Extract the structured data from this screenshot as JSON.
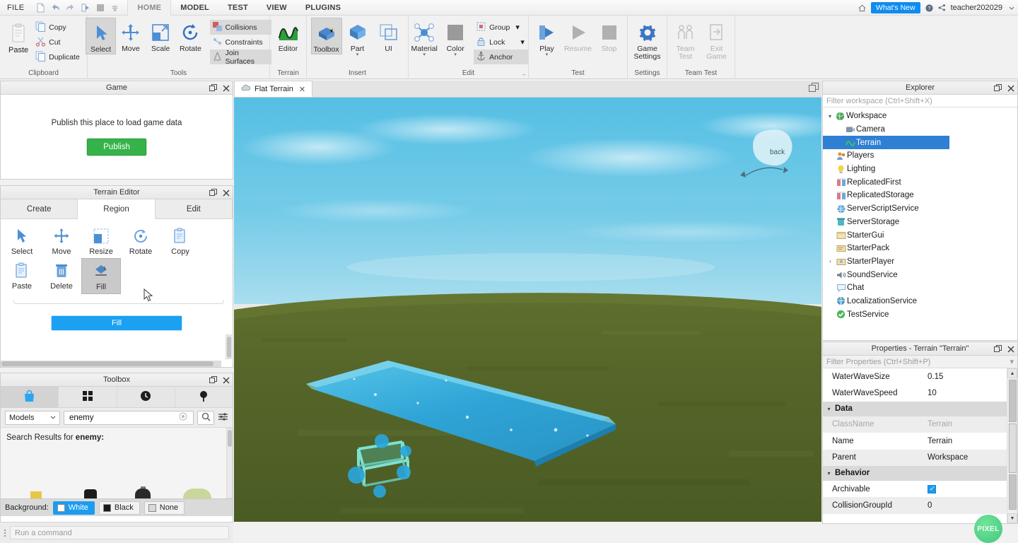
{
  "menubar": {
    "file_label": "FILE",
    "quick_access": [
      "new-file-icon",
      "undo-icon",
      "redo-icon",
      "play-forward-icon",
      "stop-square-icon",
      "qat-dropdown-icon"
    ],
    "tabs": [
      {
        "label": "HOME",
        "active": true
      },
      {
        "label": "MODEL",
        "active": false
      },
      {
        "label": "TEST",
        "active": false
      },
      {
        "label": "VIEW",
        "active": false
      },
      {
        "label": "PLUGINS",
        "active": false
      }
    ],
    "right": {
      "home_icon": "home-icon",
      "whats_new": "What's New",
      "help_icon": "help-icon",
      "share_icon": "share-icon",
      "user": "teacher202029",
      "user_caret": "chevron-down-icon"
    }
  },
  "ribbon": {
    "groups": [
      {
        "title": "Clipboard",
        "paste": {
          "label": "Paste",
          "disabled": true
        },
        "items": [
          {
            "label": "Copy",
            "icon": "copy-icon"
          },
          {
            "label": "Cut",
            "icon": "cut-icon"
          },
          {
            "label": "Duplicate",
            "icon": "duplicate-icon"
          }
        ]
      },
      {
        "title": "Tools",
        "big": [
          {
            "label": "Select",
            "icon": "cursor-arrow-icon",
            "selected": true
          },
          {
            "label": "Move",
            "icon": "move-arrows-icon",
            "selected": false
          },
          {
            "label": "Scale",
            "icon": "scale-icon",
            "selected": false
          },
          {
            "label": "Rotate",
            "icon": "rotate-icon",
            "selected": false
          }
        ],
        "small": [
          {
            "label": "Collisions",
            "icon": "collisions-icon",
            "selected": true
          },
          {
            "label": "Constraints",
            "icon": "constraints-icon",
            "selected": false
          },
          {
            "label": "Join Surfaces",
            "icon": "join-surfaces-icon",
            "selected": true
          }
        ]
      },
      {
        "title": "Terrain",
        "big": [
          {
            "label": "Editor",
            "icon": "terrain-editor-icon",
            "selected": false
          }
        ]
      },
      {
        "title": "Insert",
        "big": [
          {
            "label": "Toolbox",
            "icon": "toolbox-icon",
            "selected": true
          },
          {
            "label": "Part",
            "icon": "part-cube-icon",
            "caret": true
          },
          {
            "label": "UI",
            "icon": "ui-frame-icon"
          }
        ]
      },
      {
        "title": "Edit",
        "big": [
          {
            "label": "Material",
            "icon": "material-icon",
            "caret": true
          },
          {
            "label": "Color",
            "icon": "color-swatch-icon",
            "caret": true
          }
        ],
        "small": [
          {
            "label": "Group",
            "icon": "group-icon",
            "caret": true
          },
          {
            "label": "Lock",
            "icon": "lock-icon",
            "caret": true
          },
          {
            "label": "Anchor",
            "icon": "anchor-icon",
            "selected": true
          }
        ]
      },
      {
        "title": "Test",
        "big": [
          {
            "label": "Play",
            "icon": "play-icon",
            "caret": true
          },
          {
            "label": "Resume",
            "icon": "resume-icon",
            "disabled": true
          },
          {
            "label": "Stop",
            "icon": "stop-icon",
            "disabled": true
          }
        ]
      },
      {
        "title": "Settings",
        "big": [
          {
            "label": "Game\nSettings",
            "icon": "gear-icon"
          }
        ]
      },
      {
        "title": "Team Test",
        "big": [
          {
            "label": "Team\nTest",
            "icon": "team-test-icon",
            "disabled": true
          },
          {
            "label": "Exit\nGame",
            "icon": "exit-game-icon",
            "disabled": true
          }
        ]
      }
    ]
  },
  "game_panel": {
    "title": "Game",
    "message": "Publish this place to load game data",
    "publish_label": "Publish",
    "publish_color": "#35b34a"
  },
  "terrain_editor": {
    "title": "Terrain Editor",
    "tabs": [
      {
        "label": "Create",
        "active": false
      },
      {
        "label": "Region",
        "active": true
      },
      {
        "label": "Edit",
        "active": false
      }
    ],
    "tools": [
      {
        "label": "Select",
        "icon": "select-arrow-icon",
        "selected": false
      },
      {
        "label": "Move",
        "icon": "move-icon",
        "selected": false
      },
      {
        "label": "Resize",
        "icon": "resize-icon",
        "selected": false
      },
      {
        "label": "Rotate",
        "icon": "rotate-icon",
        "selected": false
      },
      {
        "label": "Copy",
        "icon": "copy-icon",
        "selected": false
      },
      {
        "label": "Paste",
        "icon": "paste-icon",
        "selected": false
      },
      {
        "label": "Delete",
        "icon": "trash-icon",
        "selected": false
      },
      {
        "label": "Fill",
        "icon": "fill-bucket-icon",
        "selected": true
      }
    ],
    "action_button": "Fill",
    "action_color": "#1ba0f2"
  },
  "toolbox": {
    "title": "Toolbox",
    "tabs": [
      {
        "icon": "marketplace-bag-icon",
        "active": true
      },
      {
        "icon": "inventory-grid-icon",
        "active": false
      },
      {
        "icon": "recent-clock-icon",
        "active": false
      },
      {
        "icon": "creations-pin-icon",
        "active": false
      }
    ],
    "category": "Models",
    "category_caret": "chevron-down-icon",
    "search_value": "enemy",
    "clear_icon": "clear-circle-icon",
    "search_icon": "search-icon",
    "filter_icon": "filter-sliders-icon",
    "results_prefix": "Search Results for ",
    "results_query": "enemy:",
    "background_label": "Background:",
    "background_options": [
      {
        "label": "White",
        "selected": true,
        "swatch": "#ffffff"
      },
      {
        "label": "Black",
        "selected": false,
        "swatch": "#1a1a1a"
      },
      {
        "label": "None",
        "selected": false,
        "swatch": "#d9d9d9"
      }
    ]
  },
  "command_bar": {
    "placeholder": "Run a command",
    "grip_icon": "drag-grip-icon"
  },
  "viewport": {
    "tab_label": "Flat Terrain",
    "tab_icon": "cloud-place-icon",
    "tab_close": "close-icon",
    "popout_icon": "popout-icon",
    "view_cube_label": "back",
    "sky_color": "#62c2e3",
    "ground_color": "#5d6b2c",
    "water_color": "#2fa8d8"
  },
  "explorer": {
    "title": "Explorer",
    "filter_placeholder": "Filter workspace (Ctrl+Shift+X)",
    "items": [
      {
        "label": "Workspace",
        "indent": 0,
        "arrow": "down",
        "icon": "workspace-globe-icon",
        "selected": false
      },
      {
        "label": "Camera",
        "indent": 2,
        "arrow": "",
        "icon": "camera-icon",
        "selected": false
      },
      {
        "label": "Terrain",
        "indent": 2,
        "arrow": "",
        "icon": "terrain-icon",
        "selected": true
      },
      {
        "label": "Players",
        "indent": 1,
        "arrow": "",
        "icon": "players-icon",
        "selected": false
      },
      {
        "label": "Lighting",
        "indent": 1,
        "arrow": "",
        "icon": "lighting-bulb-icon",
        "selected": false
      },
      {
        "label": "ReplicatedFirst",
        "indent": 1,
        "arrow": "",
        "icon": "replicated-icon",
        "selected": false
      },
      {
        "label": "ReplicatedStorage",
        "indent": 1,
        "arrow": "",
        "icon": "replicated-icon",
        "selected": false
      },
      {
        "label": "ServerScriptService",
        "indent": 1,
        "arrow": "",
        "icon": "server-script-icon",
        "selected": false
      },
      {
        "label": "ServerStorage",
        "indent": 1,
        "arrow": "",
        "icon": "server-storage-icon",
        "selected": false
      },
      {
        "label": "StarterGui",
        "indent": 1,
        "arrow": "",
        "icon": "starter-gui-icon",
        "selected": false
      },
      {
        "label": "StarterPack",
        "indent": 1,
        "arrow": "",
        "icon": "starter-pack-icon",
        "selected": false
      },
      {
        "label": "StarterPlayer",
        "indent": 1,
        "arrow": "right",
        "icon": "starter-player-icon",
        "selected": false
      },
      {
        "label": "SoundService",
        "indent": 1,
        "arrow": "",
        "icon": "sound-service-icon",
        "selected": false
      },
      {
        "label": "Chat",
        "indent": 1,
        "arrow": "",
        "icon": "chat-icon",
        "selected": false
      },
      {
        "label": "LocalizationService",
        "indent": 1,
        "arrow": "",
        "icon": "localization-globe-icon",
        "selected": false
      },
      {
        "label": "TestService",
        "indent": 1,
        "arrow": "",
        "icon": "test-service-icon",
        "selected": false
      }
    ]
  },
  "properties": {
    "title": "Properties - Terrain \"Terrain\"",
    "filter_placeholder": "Filter Properties (Ctrl+Shift+P)",
    "filter_caret": "chevron-down-icon",
    "rows": [
      {
        "type": "prop",
        "key": "WaterWaveSize",
        "value": "0.15",
        "dim": false
      },
      {
        "type": "prop",
        "key": "WaterWaveSpeed",
        "value": "10",
        "dim": false
      },
      {
        "type": "category",
        "key": "Data"
      },
      {
        "type": "prop",
        "key": "ClassName",
        "value": "Terrain",
        "dim": true
      },
      {
        "type": "prop",
        "key": "Name",
        "value": "Terrain",
        "dim": false
      },
      {
        "type": "prop",
        "key": "Parent",
        "value": "Workspace",
        "dim": false
      },
      {
        "type": "category",
        "key": "Behavior"
      },
      {
        "type": "checkbox",
        "key": "Archivable",
        "value": true,
        "dim": false
      },
      {
        "type": "prop",
        "key": "CollisionGroupId",
        "value": "0",
        "dim": false
      }
    ]
  },
  "watermark": {
    "label": "PIXEL",
    "color": "#3fc87c"
  }
}
